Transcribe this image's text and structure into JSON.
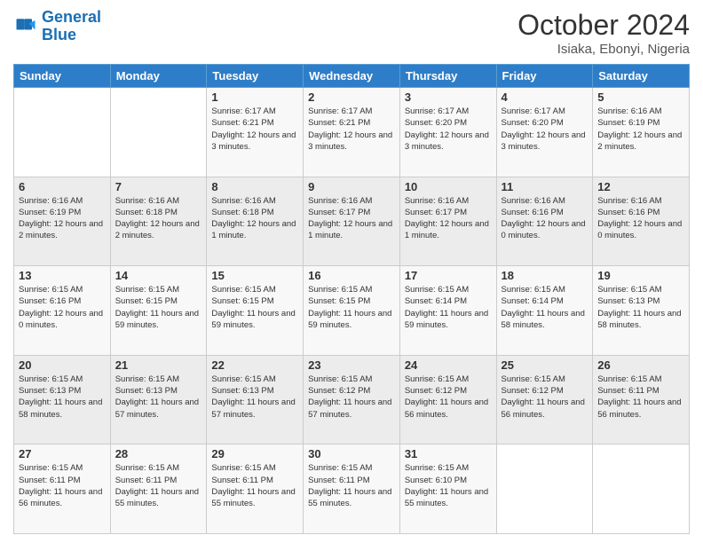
{
  "logo": {
    "line1": "General",
    "line2": "Blue"
  },
  "title": "October 2024",
  "subtitle": "Isiaka, Ebonyi, Nigeria",
  "weekdays": [
    "Sunday",
    "Monday",
    "Tuesday",
    "Wednesday",
    "Thursday",
    "Friday",
    "Saturday"
  ],
  "weeks": [
    [
      {
        "day": "",
        "sunrise": "",
        "sunset": "",
        "daylight": ""
      },
      {
        "day": "",
        "sunrise": "",
        "sunset": "",
        "daylight": ""
      },
      {
        "day": "1",
        "sunrise": "Sunrise: 6:17 AM",
        "sunset": "Sunset: 6:21 PM",
        "daylight": "Daylight: 12 hours and 3 minutes."
      },
      {
        "day": "2",
        "sunrise": "Sunrise: 6:17 AM",
        "sunset": "Sunset: 6:21 PM",
        "daylight": "Daylight: 12 hours and 3 minutes."
      },
      {
        "day": "3",
        "sunrise": "Sunrise: 6:17 AM",
        "sunset": "Sunset: 6:20 PM",
        "daylight": "Daylight: 12 hours and 3 minutes."
      },
      {
        "day": "4",
        "sunrise": "Sunrise: 6:17 AM",
        "sunset": "Sunset: 6:20 PM",
        "daylight": "Daylight: 12 hours and 3 minutes."
      },
      {
        "day": "5",
        "sunrise": "Sunrise: 6:16 AM",
        "sunset": "Sunset: 6:19 PM",
        "daylight": "Daylight: 12 hours and 2 minutes."
      }
    ],
    [
      {
        "day": "6",
        "sunrise": "Sunrise: 6:16 AM",
        "sunset": "Sunset: 6:19 PM",
        "daylight": "Daylight: 12 hours and 2 minutes."
      },
      {
        "day": "7",
        "sunrise": "Sunrise: 6:16 AM",
        "sunset": "Sunset: 6:18 PM",
        "daylight": "Daylight: 12 hours and 2 minutes."
      },
      {
        "day": "8",
        "sunrise": "Sunrise: 6:16 AM",
        "sunset": "Sunset: 6:18 PM",
        "daylight": "Daylight: 12 hours and 1 minute."
      },
      {
        "day": "9",
        "sunrise": "Sunrise: 6:16 AM",
        "sunset": "Sunset: 6:17 PM",
        "daylight": "Daylight: 12 hours and 1 minute."
      },
      {
        "day": "10",
        "sunrise": "Sunrise: 6:16 AM",
        "sunset": "Sunset: 6:17 PM",
        "daylight": "Daylight: 12 hours and 1 minute."
      },
      {
        "day": "11",
        "sunrise": "Sunrise: 6:16 AM",
        "sunset": "Sunset: 6:16 PM",
        "daylight": "Daylight: 12 hours and 0 minutes."
      },
      {
        "day": "12",
        "sunrise": "Sunrise: 6:16 AM",
        "sunset": "Sunset: 6:16 PM",
        "daylight": "Daylight: 12 hours and 0 minutes."
      }
    ],
    [
      {
        "day": "13",
        "sunrise": "Sunrise: 6:15 AM",
        "sunset": "Sunset: 6:16 PM",
        "daylight": "Daylight: 12 hours and 0 minutes."
      },
      {
        "day": "14",
        "sunrise": "Sunrise: 6:15 AM",
        "sunset": "Sunset: 6:15 PM",
        "daylight": "Daylight: 11 hours and 59 minutes."
      },
      {
        "day": "15",
        "sunrise": "Sunrise: 6:15 AM",
        "sunset": "Sunset: 6:15 PM",
        "daylight": "Daylight: 11 hours and 59 minutes."
      },
      {
        "day": "16",
        "sunrise": "Sunrise: 6:15 AM",
        "sunset": "Sunset: 6:15 PM",
        "daylight": "Daylight: 11 hours and 59 minutes."
      },
      {
        "day": "17",
        "sunrise": "Sunrise: 6:15 AM",
        "sunset": "Sunset: 6:14 PM",
        "daylight": "Daylight: 11 hours and 59 minutes."
      },
      {
        "day": "18",
        "sunrise": "Sunrise: 6:15 AM",
        "sunset": "Sunset: 6:14 PM",
        "daylight": "Daylight: 11 hours and 58 minutes."
      },
      {
        "day": "19",
        "sunrise": "Sunrise: 6:15 AM",
        "sunset": "Sunset: 6:13 PM",
        "daylight": "Daylight: 11 hours and 58 minutes."
      }
    ],
    [
      {
        "day": "20",
        "sunrise": "Sunrise: 6:15 AM",
        "sunset": "Sunset: 6:13 PM",
        "daylight": "Daylight: 11 hours and 58 minutes."
      },
      {
        "day": "21",
        "sunrise": "Sunrise: 6:15 AM",
        "sunset": "Sunset: 6:13 PM",
        "daylight": "Daylight: 11 hours and 57 minutes."
      },
      {
        "day": "22",
        "sunrise": "Sunrise: 6:15 AM",
        "sunset": "Sunset: 6:13 PM",
        "daylight": "Daylight: 11 hours and 57 minutes."
      },
      {
        "day": "23",
        "sunrise": "Sunrise: 6:15 AM",
        "sunset": "Sunset: 6:12 PM",
        "daylight": "Daylight: 11 hours and 57 minutes."
      },
      {
        "day": "24",
        "sunrise": "Sunrise: 6:15 AM",
        "sunset": "Sunset: 6:12 PM",
        "daylight": "Daylight: 11 hours and 56 minutes."
      },
      {
        "day": "25",
        "sunrise": "Sunrise: 6:15 AM",
        "sunset": "Sunset: 6:12 PM",
        "daylight": "Daylight: 11 hours and 56 minutes."
      },
      {
        "day": "26",
        "sunrise": "Sunrise: 6:15 AM",
        "sunset": "Sunset: 6:11 PM",
        "daylight": "Daylight: 11 hours and 56 minutes."
      }
    ],
    [
      {
        "day": "27",
        "sunrise": "Sunrise: 6:15 AM",
        "sunset": "Sunset: 6:11 PM",
        "daylight": "Daylight: 11 hours and 56 minutes."
      },
      {
        "day": "28",
        "sunrise": "Sunrise: 6:15 AM",
        "sunset": "Sunset: 6:11 PM",
        "daylight": "Daylight: 11 hours and 55 minutes."
      },
      {
        "day": "29",
        "sunrise": "Sunrise: 6:15 AM",
        "sunset": "Sunset: 6:11 PM",
        "daylight": "Daylight: 11 hours and 55 minutes."
      },
      {
        "day": "30",
        "sunrise": "Sunrise: 6:15 AM",
        "sunset": "Sunset: 6:11 PM",
        "daylight": "Daylight: 11 hours and 55 minutes."
      },
      {
        "day": "31",
        "sunrise": "Sunrise: 6:15 AM",
        "sunset": "Sunset: 6:10 PM",
        "daylight": "Daylight: 11 hours and 55 minutes."
      },
      {
        "day": "",
        "sunrise": "",
        "sunset": "",
        "daylight": ""
      },
      {
        "day": "",
        "sunrise": "",
        "sunset": "",
        "daylight": ""
      }
    ]
  ]
}
